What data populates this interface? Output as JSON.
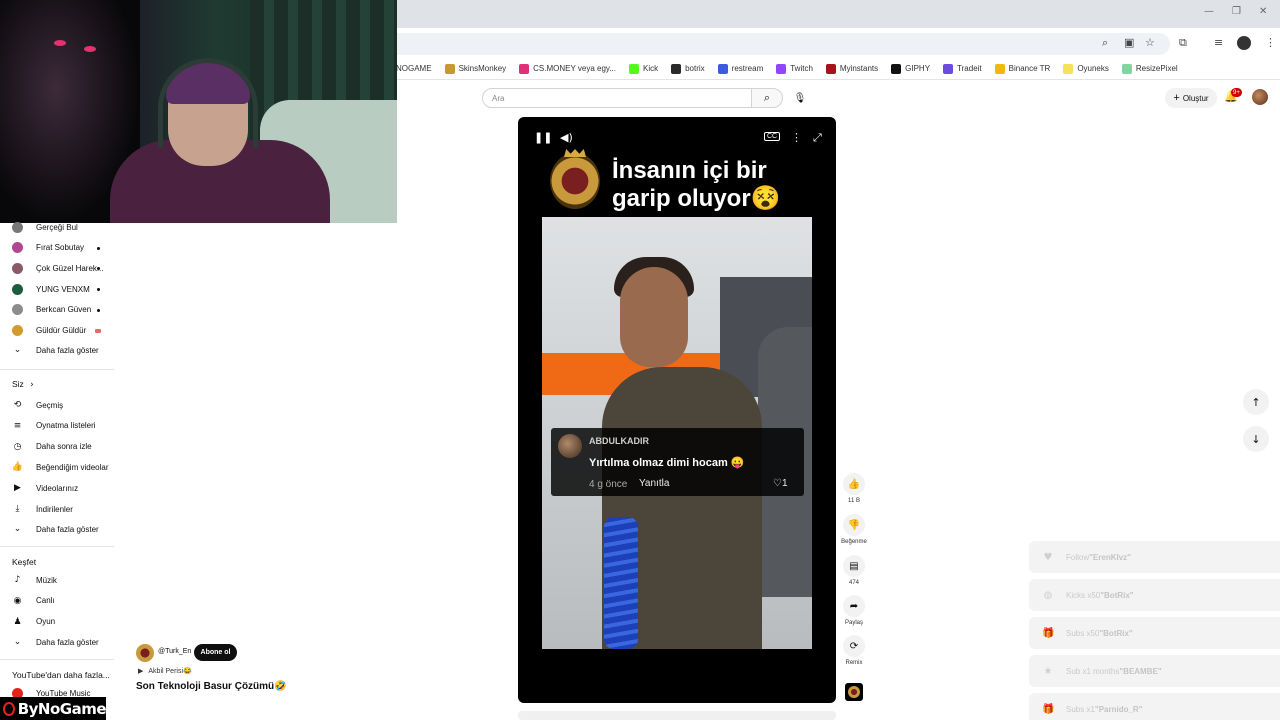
{
  "browser": {
    "bookmarks": [
      {
        "label": "NOGAME",
        "color": "#ffffff"
      },
      {
        "label": "SkinsMonkey",
        "color": "#c79a2d"
      },
      {
        "label": "CS.MONEY veya egy...",
        "color": "#e0307a"
      },
      {
        "label": "Kick",
        "color": "#53fc18"
      },
      {
        "label": "botrix",
        "color": "#2a2a2a"
      },
      {
        "label": "restream",
        "color": "#3c5be0"
      },
      {
        "label": "Twitch",
        "color": "#9146ff"
      },
      {
        "label": "Myinstants",
        "color": "#a8121e"
      },
      {
        "label": "GIPHY",
        "color": "#111111"
      },
      {
        "label": "Tradeit",
        "color": "#6c4ce0"
      },
      {
        "label": "Binance TR",
        "color": "#f0b90b"
      },
      {
        "label": "Oyuneks",
        "color": "#f6e15a"
      },
      {
        "label": "ResizePixel",
        "color": "#7fd6a0"
      }
    ]
  },
  "header": {
    "search_placeholder": "Ara",
    "create_label": "Oluştur",
    "notification_count": "9+"
  },
  "sidebar": {
    "subscriptions": [
      {
        "label": "Gerçeği Bul",
        "color": "#777777",
        "dot": false
      },
      {
        "label": "Fırat Sobutay",
        "color": "#b0488f",
        "dot": true
      },
      {
        "label": "Çok Güzel Harek...",
        "color": "#8a5a66",
        "dot": true
      },
      {
        "label": "YUNG VENXM",
        "color": "#1d5c3b",
        "dot": true
      },
      {
        "label": "Berkcan Güven",
        "color": "#8c8c8c",
        "dot": true
      },
      {
        "label": "Güldür Güldür",
        "color": "#d39a2e",
        "dot": false,
        "live": true
      }
    ],
    "subs_more": "Daha fazla göster",
    "you_title": "Siz",
    "you_items": [
      {
        "label": "Geçmiş",
        "icon": "history-icon"
      },
      {
        "label": "Oynatma listeleri",
        "icon": "playlist-icon"
      },
      {
        "label": "Daha sonra izle",
        "icon": "clock-icon"
      },
      {
        "label": "Beğendiğim videolar",
        "icon": "thumbs-up-icon"
      },
      {
        "label": "Videolarınız",
        "icon": "video-icon"
      },
      {
        "label": "İndirilenler",
        "icon": "download-icon"
      }
    ],
    "you_more": "Daha fazla göster",
    "explore_title": "Keşfet",
    "explore_items": [
      {
        "label": "Müzik",
        "icon": "music-icon"
      },
      {
        "label": "Canlı",
        "icon": "live-icon"
      },
      {
        "label": "Oyun",
        "icon": "gaming-icon"
      }
    ],
    "explore_more": "Daha fazla göster",
    "more_from_youtube": "YouTube'dan daha fazla...",
    "youtube_music": "YouTube Music"
  },
  "short": {
    "caption_line1": "İnsanın içi bir",
    "caption_line2": "garip oluyor😵",
    "comment": {
      "username": "ABDULKADIR",
      "text": "Yırtılma olmaz dimi hocam 😛",
      "time": "4 g önce",
      "reply": "Yanıtla",
      "likes": "1"
    }
  },
  "actions": {
    "like_count": "11 B",
    "dislike_label": "Beğenme",
    "comment_count": "474",
    "share_label": "Paylaş",
    "remix_label": "Remix"
  },
  "channel": {
    "handle": "@Turk_En",
    "subscribe_label": "Abone ol",
    "music": "Akbil Perisi😂",
    "title": "Son Teknoloji Basur Çözümü🤣"
  },
  "alerts": [
    {
      "text": "Follow ",
      "name": "\"ErenKlvz\"",
      "icon": "heart-icon"
    },
    {
      "text": "Kicks x50 ",
      "name": "\"BotRix\"",
      "icon": "kick-icon"
    },
    {
      "text": "Subs x50 ",
      "name": "\"BotRix\"",
      "icon": "gift-icon"
    },
    {
      "text": "Sub x1 months ",
      "name": "\"BEAMBE\"",
      "icon": "star-icon"
    },
    {
      "text": "Subs x1 ",
      "name": "\"Parnido_R\"",
      "icon": "gift-icon"
    }
  ],
  "overlay": {
    "brand": "ByNoGame"
  }
}
